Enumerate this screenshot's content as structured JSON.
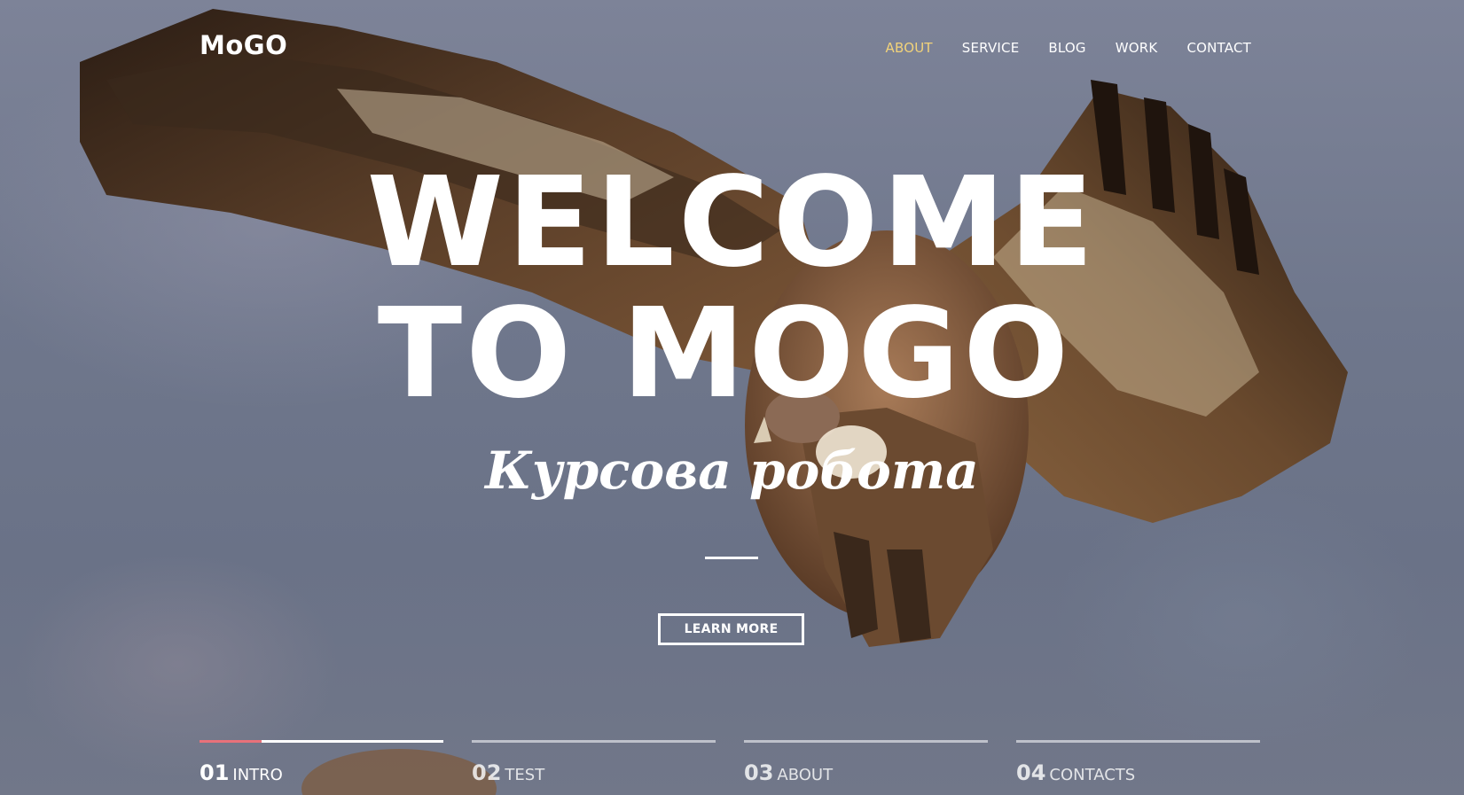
{
  "brand": {
    "logo": "MoGO"
  },
  "nav": {
    "items": [
      {
        "label": "ABOUT",
        "active": true
      },
      {
        "label": "SERVICE"
      },
      {
        "label": "BLOG"
      },
      {
        "label": "WORK"
      },
      {
        "label": "CONTACT"
      }
    ]
  },
  "hero": {
    "line1": "WELCOME",
    "line2": "TO MOGO",
    "subtitle": "Курсова робота",
    "button_label": "LEARN MORE"
  },
  "slides": [
    {
      "num": "01",
      "label": "INTRO",
      "active": true
    },
    {
      "num": "02",
      "label": "TEST"
    },
    {
      "num": "03",
      "label": "ABOUT"
    },
    {
      "num": "04",
      "label": "CONTACTS"
    }
  ],
  "colors": {
    "accent_nav": "#f2d37a",
    "progress": "#e8717a",
    "text": "#ffffff"
  }
}
